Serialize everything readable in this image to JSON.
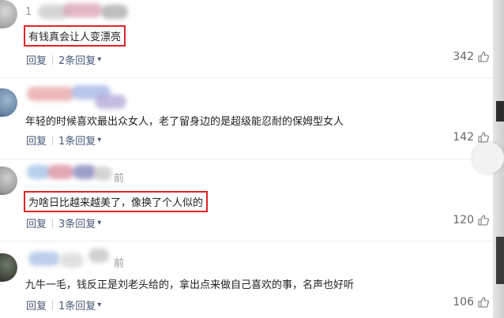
{
  "comments": [
    {
      "username": "1",
      "text": "有钱真会让人变漂亮",
      "reply_label": "回复",
      "replies_label": "2条回复",
      "likes": "342"
    },
    {
      "username": "",
      "text": "年轻的时候喜欢最出众女人，老了留身边的是超级能忍耐的保姆型女人",
      "reply_label": "回复",
      "replies_label": "1条回复",
      "likes": "142"
    },
    {
      "username": "前",
      "text": "为啥日比越来越美了，像换了个人似的",
      "reply_label": "回复",
      "replies_label": "3条回复",
      "likes": "120"
    },
    {
      "username": "前",
      "text": "九牛一毛，钱反正是刘老头给的，拿出点来做自己喜欢的事，名声也好听",
      "reply_label": "回复",
      "replies_label": "1条回复",
      "likes": "106"
    }
  ],
  "icons": {
    "expand": "chevron-down-icon",
    "like": "thumbs-up-icon"
  },
  "colors": {
    "highlight_box": "#e02424",
    "link": "#4a5a78"
  }
}
